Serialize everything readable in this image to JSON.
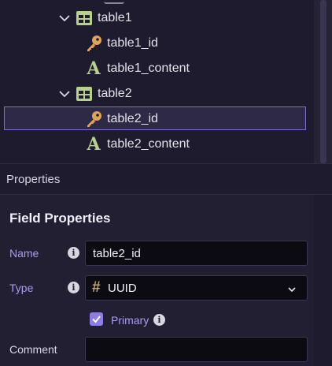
{
  "tree": {
    "tables": [
      {
        "name": "table1",
        "fields": [
          {
            "name": "table1_id",
            "kind": "key-icon"
          },
          {
            "name": "table1_content",
            "kind": "text-icon"
          }
        ]
      },
      {
        "name": "table2",
        "fields": [
          {
            "name": "table2_id",
            "kind": "key-icon"
          },
          {
            "name": "table2_content",
            "kind": "text-icon"
          }
        ]
      }
    ],
    "selected": "table2_id"
  },
  "properties": {
    "panel_title": "Properties",
    "section_title": "Field Properties",
    "name_label": "Name",
    "name_value": "table2_id",
    "type_label": "Type",
    "type_symbol": "#",
    "type_value": "UUID",
    "primary_label": "Primary",
    "primary_checked": true,
    "comment_label": "Comment",
    "comment_value": ""
  },
  "colors": {
    "background": "#1f1b2e",
    "accent": "#8b7ee6",
    "label_purple": "#a99cf0",
    "table_icon": "#b9cf8f",
    "key_icon": "#e0a254"
  }
}
